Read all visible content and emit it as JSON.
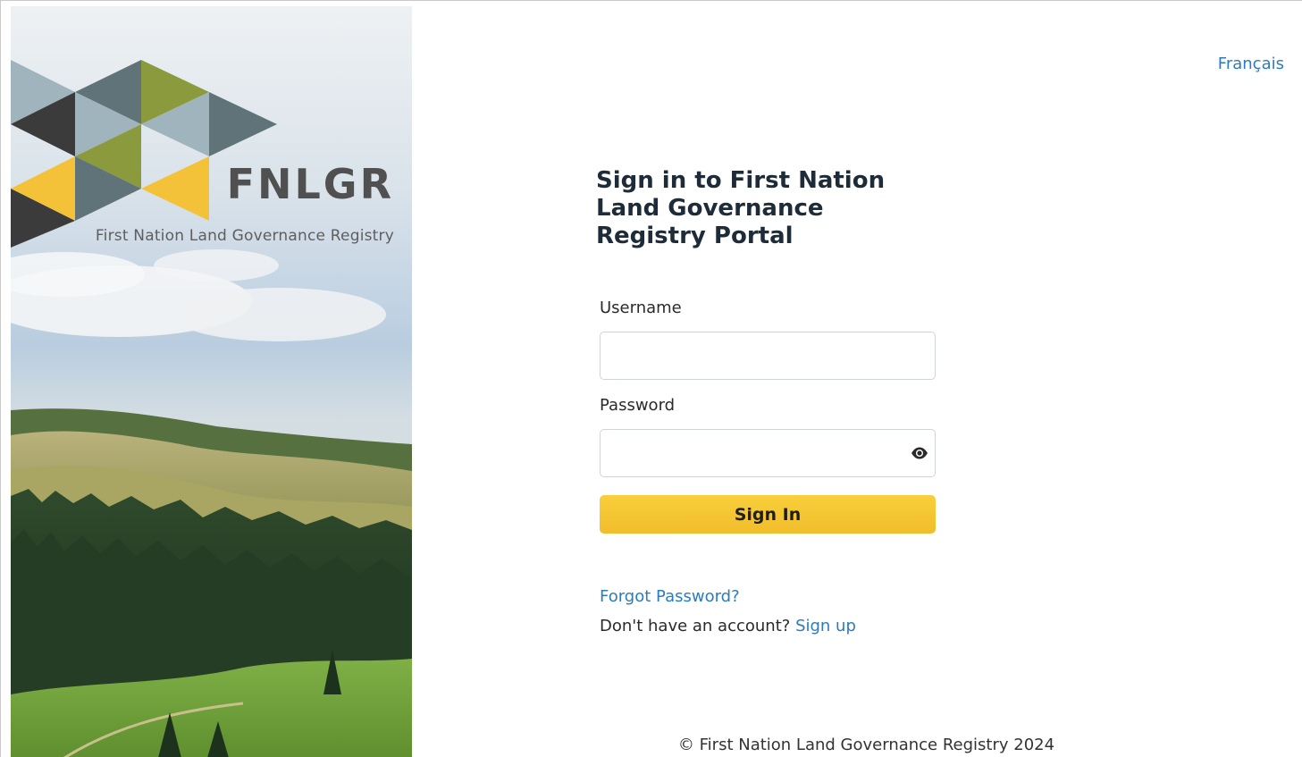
{
  "hero": {
    "logo_acronym": "FNLGR",
    "logo_fullname": "First Nation Land Governance Registry"
  },
  "header": {
    "language_link": "Français"
  },
  "login": {
    "title": "Sign in to First Nation Land Governance Registry Portal",
    "username_label": "Username",
    "username_value": "",
    "password_label": "Password",
    "password_value": "",
    "show_password_icon": "eye-icon",
    "sign_in_label": "Sign In",
    "forgot_password": "Forgot Password?",
    "no_account_text": "Don't have an account?",
    "sign_up_link": "Sign up"
  },
  "footer": {
    "copyright": "© First Nation Land Governance Registry 2024"
  },
  "colors": {
    "link": "#2b7bbf",
    "button": "#f5c533",
    "title": "#1e2b38",
    "logo_dark": "#505050",
    "logo_olive": "#8c9a3e",
    "logo_yellow": "#f3c238",
    "logo_slate": "#5f7378",
    "logo_light": "#9fb4bc"
  }
}
